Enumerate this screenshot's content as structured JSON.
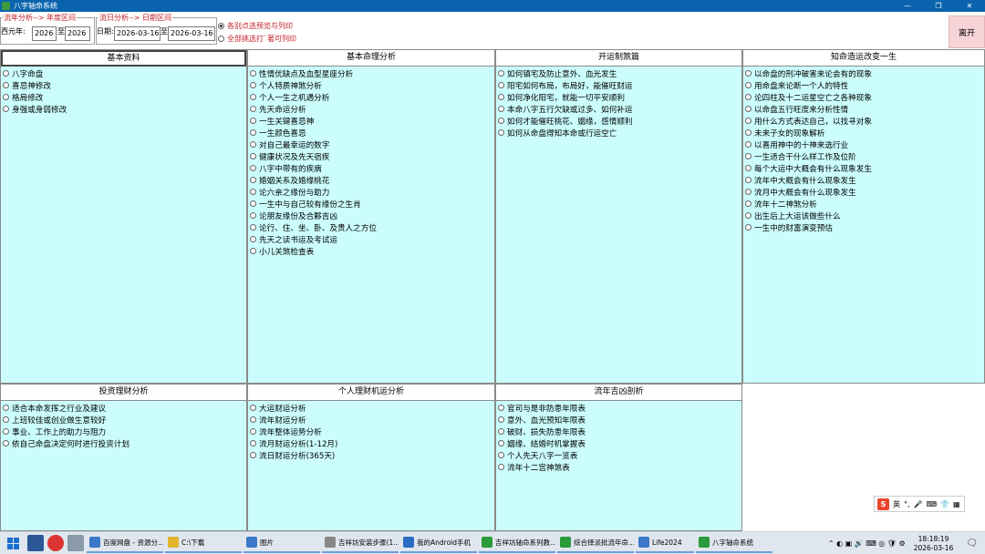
{
  "window": {
    "title": "八字轴命系统",
    "min": "—",
    "max": "❐",
    "close": "✕"
  },
  "toolbar": {
    "year_group": {
      "legend": "流年分析--> 年度区间",
      "label": "西元年:",
      "from": "2026",
      "to_label": "至",
      "to": "2026"
    },
    "day_group": {
      "legend": "流日分析--> 日期区间",
      "label": "日期:",
      "from": "2026-03-16",
      "to_label": "至",
      "to": "2026-03-16"
    },
    "radio_preview": "各别点选预览与列印",
    "radio_print_all": "全部挑选打`著可列印",
    "exit_label": "离开"
  },
  "panels": [
    {
      "title": "基本资料",
      "items": [
        "八字命盘",
        "喜忌神修改",
        "格局修改",
        "身强或身弱修改"
      ]
    },
    {
      "title": "基本命理分析",
      "items": [
        "性情优缺点及血型星座分析",
        "个人特质神煞分析",
        "个人一生之机遇分析",
        "先天命运分析",
        "一生关键喜忌神",
        "一生颜色喜忌",
        "对自己最幸运的数字",
        "健康状况及先天宿疾",
        "八字中带有的疾病",
        "婚姻关系及婚缘桃花",
        "论六亲之缘份与助力",
        "一生中与自己较有缘份之生肖",
        "论朋友缘份及合夥吉凶",
        "论行、住、坐、卧、及贵人之方位",
        "先天之读书运及考试运",
        "小儿关煞检查表"
      ]
    },
    {
      "title": "开运制煞篇",
      "items": [
        "如何镇宅及防止意外、血光发生",
        "阳宅如何布局，布局好，能催旺财运",
        "如何净化阳宅，就能一切平安顺利",
        "本命八字五行欠缺或过多、如何补运",
        "如何才能催旺桃花、姻缘，感情顺利",
        "如何从命盘得知本命或行运空亡"
      ]
    },
    {
      "title": "知命造运改变一生",
      "items": [
        "以命盘的刑冲破害来论会有的现象",
        "用命盘来论断一个人的特性",
        "论四柱及十二运星空亡之各种现象",
        "以命盘五行旺度来分析性情",
        "用什么方式表达自己，以找寻对象",
        "未来子女的现象解析",
        "以喜用神中的十神来选行业",
        "一生适合干什么样工作及位阶",
        "每个大运中大概会有什么现象发生",
        "流年中大概会有什么现象发生",
        "流月中大概会有什么现象发生",
        "流年十二神煞分析",
        "出生后上大运该做些什么",
        "一生中的财富演变预估"
      ]
    },
    {
      "title": "投资理财分析",
      "items": [
        "适合本命发挥之行业及建议",
        "上班较佳或创业做生意较好",
        "事业、工作上的助力与阻力",
        "依自己命盘决定何时进行投资计划"
      ]
    },
    {
      "title": "个人理财机运分析",
      "items": [
        "大运财运分析",
        "流年财运分析",
        "流年整体运势分析",
        "流月财运分析(1-12月)",
        "流日财运分析(365天)"
      ]
    },
    {
      "title": "流年吉凶剖析",
      "items": [
        "官司与是非防患年限表",
        "意外、血光预知年限表",
        "破财、损失防患年限表",
        "姻缘、结婚时机掌握表",
        "个人先天八字一览表",
        "流年十二宫神煞表"
      ]
    }
  ],
  "ime": {
    "label": "英"
  },
  "taskbar": {
    "tasks": [
      "百度网盘 - 资源分...",
      "C:\\下载",
      "图片",
      "吉祥坊安装步骤(1...",
      "我的Android手机",
      "吉祥坊轴命系列教...",
      "综合择派批流年命...",
      "Life2024",
      "八字轴命系统"
    ],
    "time": "18:18:19",
    "date": "2026-03-16"
  },
  "colors": {
    "panel_bg": "#ccfdfd",
    "legend_red": "#c0202a",
    "titlebar_blue": "#0a64ad",
    "exit_bg": "#f5d3d7"
  }
}
